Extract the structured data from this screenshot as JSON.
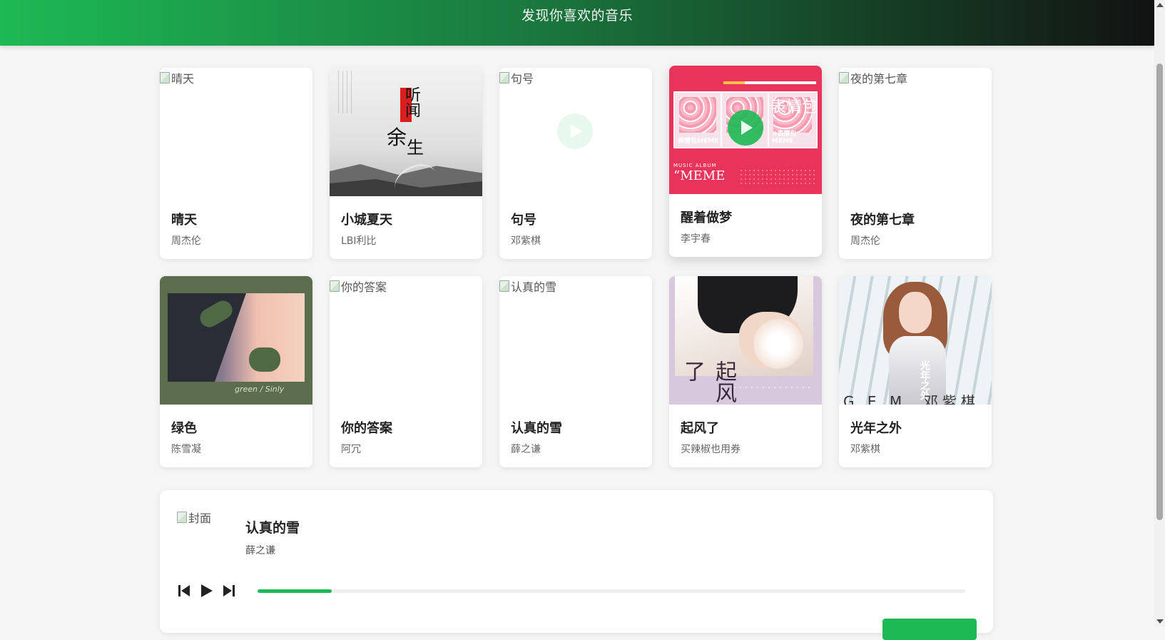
{
  "header": {
    "title": "发现你喜欢的音乐"
  },
  "songs": [
    {
      "title": "晴天",
      "artist": "周杰伦",
      "cover_alt": "晴天"
    },
    {
      "title": "小城夏天",
      "artist": "LBI利比",
      "cover_alt": "小城夏天",
      "cover_text": [
        "听",
        "闻",
        "余",
        "生"
      ]
    },
    {
      "title": "句号",
      "artist": "邓紫棋",
      "cover_alt": "句号"
    },
    {
      "title": "醒着做梦",
      "artist": "李宇春",
      "cover_alt": "醒着做梦",
      "cover_text": [
        "表情包MEME",
        "#表情包MEME",
        "MUSIC ALBUM",
        "“MEME",
        "表情包"
      ]
    },
    {
      "title": "夜的第七章",
      "artist": "周杰伦",
      "cover_alt": "夜的第七章"
    },
    {
      "title": "绿色",
      "artist": "陈雪凝",
      "cover_alt": "绿色",
      "cover_text": [
        "green / Sinly"
      ]
    },
    {
      "title": "你的答案",
      "artist": "阿冗",
      "cover_alt": "你的答案"
    },
    {
      "title": "认真的雪",
      "artist": "薛之谦",
      "cover_alt": "认真的雪"
    },
    {
      "title": "起风了",
      "artist": "买辣椒也用券",
      "cover_alt": "起风了",
      "cover_text": [
        "起风了"
      ]
    },
    {
      "title": "光年之外",
      "artist": "邓紫棋",
      "cover_alt": "光年之外",
      "cover_text": [
        "光年之外",
        "G.E.M. 邓紫棋"
      ]
    }
  ],
  "player": {
    "cover_alt": "封面",
    "title": "认真的雪",
    "artist": "薛之谦",
    "progress": 0.105,
    "controls": [
      "previous-icon",
      "play-icon",
      "next-icon"
    ]
  },
  "colors": {
    "accent": "#1db954",
    "header_start": "#1db954",
    "header_end": "#121212"
  }
}
